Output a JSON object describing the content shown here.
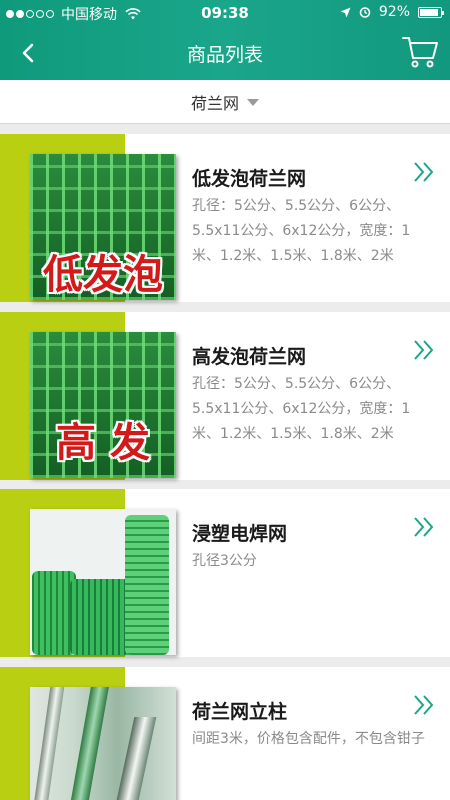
{
  "status_bar": {
    "carrier": "中国移动",
    "time": "09:38",
    "battery": "92%",
    "battery_level": 0.92
  },
  "nav": {
    "title": "商品列表",
    "back_icon": "back-chevron-icon",
    "cart_icon": "shopping-cart-icon"
  },
  "filter": {
    "label": "荷兰网"
  },
  "colors": {
    "header": "#1aa68a",
    "accent": "#b9cf12",
    "arrow": "#1aa68a",
    "thumb_text": "#d31a1a"
  },
  "products": [
    {
      "title": "低发泡荷兰网",
      "desc": "孔径：5公分、5.5公分、6公分、5.5x11公分、6x12公分，宽度：1米、1.2米、1.5米、1.8米、2米",
      "thumb_text": "低发泡"
    },
    {
      "title": "高发泡荷兰网",
      "desc": "孔径：5公分、5.5公分、6公分、5.5x11公分、6x12公分，宽度：1米、1.2米、1.5米、1.8米、2米",
      "thumb_text": "高  发"
    },
    {
      "title": "浸塑电焊网",
      "desc": "孔径3公分"
    },
    {
      "title": "荷兰网立柱",
      "desc": "间距3米，价格包含配件，不包含钳子"
    }
  ]
}
